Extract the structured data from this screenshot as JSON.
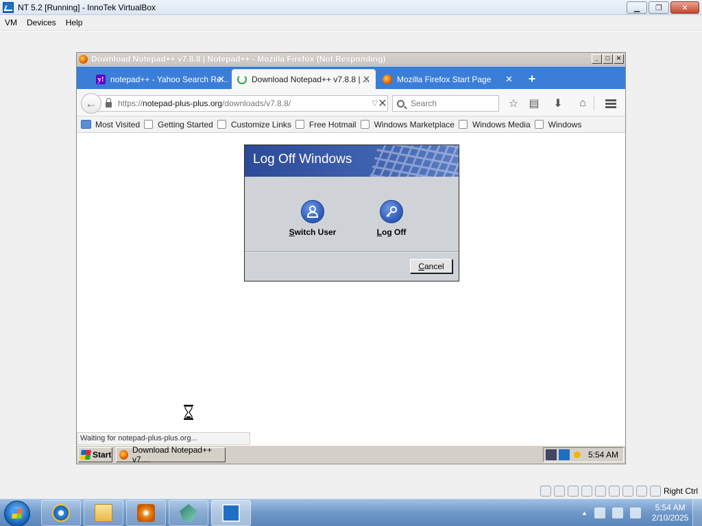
{
  "host": {
    "title": "NT 5.2 [Running] - InnoTek VirtualBox",
    "menu": [
      "VM",
      "Devices",
      "Help"
    ],
    "status_key": "Right Ctrl",
    "clock_time": "5:54 AM",
    "clock_date": "2/10/2025"
  },
  "firefox": {
    "title": "Download Notepad++ v7.8.8 | Notepad++ - Mozilla Firefox (Not Responding)",
    "tabs": [
      {
        "label": "notepad++ - Yahoo Search Re..."
      },
      {
        "label": "Download Notepad++ v7.8.8 | ..."
      },
      {
        "label": "Mozilla Firefox Start Page"
      }
    ],
    "url_prefix": "https://",
    "url_host": "notepad-plus-plus.org",
    "url_path": "/downloads/v7.8.8/",
    "search_placeholder": "Search",
    "bookmarks": [
      "Most Visited",
      "Getting Started",
      "Customize Links",
      "Free Hotmail",
      "Windows Marketplace",
      "Windows Media",
      "Windows"
    ],
    "status_text": "Waiting for notepad-plus-plus.org..."
  },
  "dialog": {
    "title": "Log Off Windows",
    "switch_user_underline": "S",
    "switch_user_rest": "witch User",
    "log_off_underline": "L",
    "log_off_rest": "og Off",
    "cancel_underline": "C",
    "cancel_rest": "ancel"
  },
  "guest_taskbar": {
    "start_label": "Start",
    "task_label": "Download Notepad++ v7....",
    "clock": "5:54 AM"
  }
}
